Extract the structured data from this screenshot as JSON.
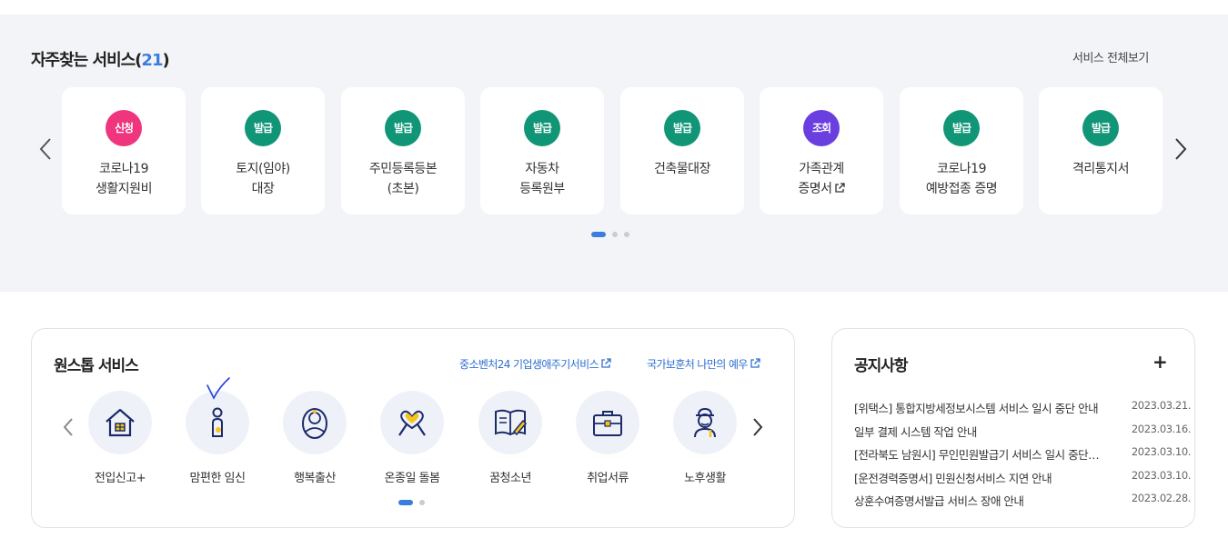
{
  "frequent": {
    "title": "자주찾는 서비스(",
    "count": "21",
    "title_close": ")",
    "view_all": "서비스 전체보기",
    "cards": [
      {
        "badge": "신청",
        "badge_color": "#f0357f",
        "label": "코로나19\n생활지원비",
        "external": false
      },
      {
        "badge": "발급",
        "badge_color": "#119577",
        "label": "토지(임야)\n대장",
        "external": false
      },
      {
        "badge": "발급",
        "badge_color": "#119577",
        "label": "주민등록등본\n(초본)",
        "external": false
      },
      {
        "badge": "발급",
        "badge_color": "#119577",
        "label": "자동차\n등록원부",
        "external": false
      },
      {
        "badge": "발급",
        "badge_color": "#119577",
        "label": "건축물대장",
        "external": false
      },
      {
        "badge": "조회",
        "badge_color": "#6a3fe0",
        "label": "가족관계\n증명서",
        "external": true
      },
      {
        "badge": "발급",
        "badge_color": "#119577",
        "label": "코로나19\n예방접종 증명",
        "external": false
      },
      {
        "badge": "발급",
        "badge_color": "#119577",
        "label": "격리통지서",
        "external": false
      }
    ],
    "pages": 3,
    "active_page": 1
  },
  "onestop": {
    "title": "원스톱 서비스",
    "links": [
      "중소벤처24 기업생애주기서비스",
      "국가보훈처 나만의 예우"
    ],
    "items": [
      {
        "label": "전입신고+",
        "icon": "house-icon"
      },
      {
        "label": "맘편한 임신",
        "icon": "pregnant-icon"
      },
      {
        "label": "행복출산",
        "icon": "baby-icon"
      },
      {
        "label": "온종일 돌봄",
        "icon": "heart-ribbon-icon"
      },
      {
        "label": "꿈청소년",
        "icon": "book-pen-icon"
      },
      {
        "label": "취업서류",
        "icon": "briefcase-icon"
      },
      {
        "label": "노후생활",
        "icon": "elder-icon"
      }
    ],
    "pages": 2,
    "active_page": 1
  },
  "notice": {
    "title": "공지사항",
    "more": "+",
    "items": [
      {
        "text": "[위택스] 통합지방세정보시스템 서비스 일시 중단 안내",
        "date": "2023.03.21."
      },
      {
        "text": "일부 결제 시스템 작업 안내",
        "date": "2023.03.16."
      },
      {
        "text": "[전라북도 남원시] 무인민원발급기 서비스 일시 중단 안내",
        "date": "2023.03.10."
      },
      {
        "text": "[운전경력증명서] 민원신청서비스 지연 안내",
        "date": "2023.03.10."
      },
      {
        "text": "상훈수여증명서발급 서비스 장애 안내",
        "date": "2023.02.28."
      }
    ]
  },
  "colors": {
    "accent": "#3b7ddd",
    "icon_navy": "#1c2a6b",
    "icon_yellow": "#f5c518"
  }
}
